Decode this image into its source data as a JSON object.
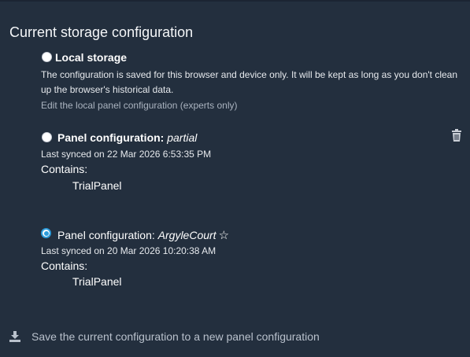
{
  "page_title": "Current storage configuration",
  "local_storage": {
    "label": "Local storage",
    "description_line1": "The configuration is saved for this browser and device only. It will be kept as long as you don't clean",
    "description_line2": "up the browser's historical data.",
    "edit_link": "Edit the local panel configuration (experts only)",
    "selected": false
  },
  "configs": [
    {
      "label_prefix": "Panel configuration:",
      "name": "partial",
      "synced": "Last synced on 22 Mar 2026 6:53:35 PM",
      "contains_label": "Contains:",
      "panels": [
        "TrialPanel"
      ],
      "selected": false,
      "has_delete": true,
      "starred": false
    },
    {
      "label_prefix": "Panel configuration:",
      "name": "ArgyleCourt",
      "synced": "Last synced on 20 Mar 2026 10:20:38 AM",
      "contains_label": "Contains:",
      "panels": [
        "TrialPanel"
      ],
      "selected": true,
      "has_delete": false,
      "starred": false
    }
  ],
  "save_action": {
    "label": "Save the current configuration to a new panel configuration",
    "icon": "download-icon"
  },
  "colors": {
    "background": "#232f3e",
    "accent": "#2d9cdb",
    "muted_text": "#aab3bf"
  }
}
